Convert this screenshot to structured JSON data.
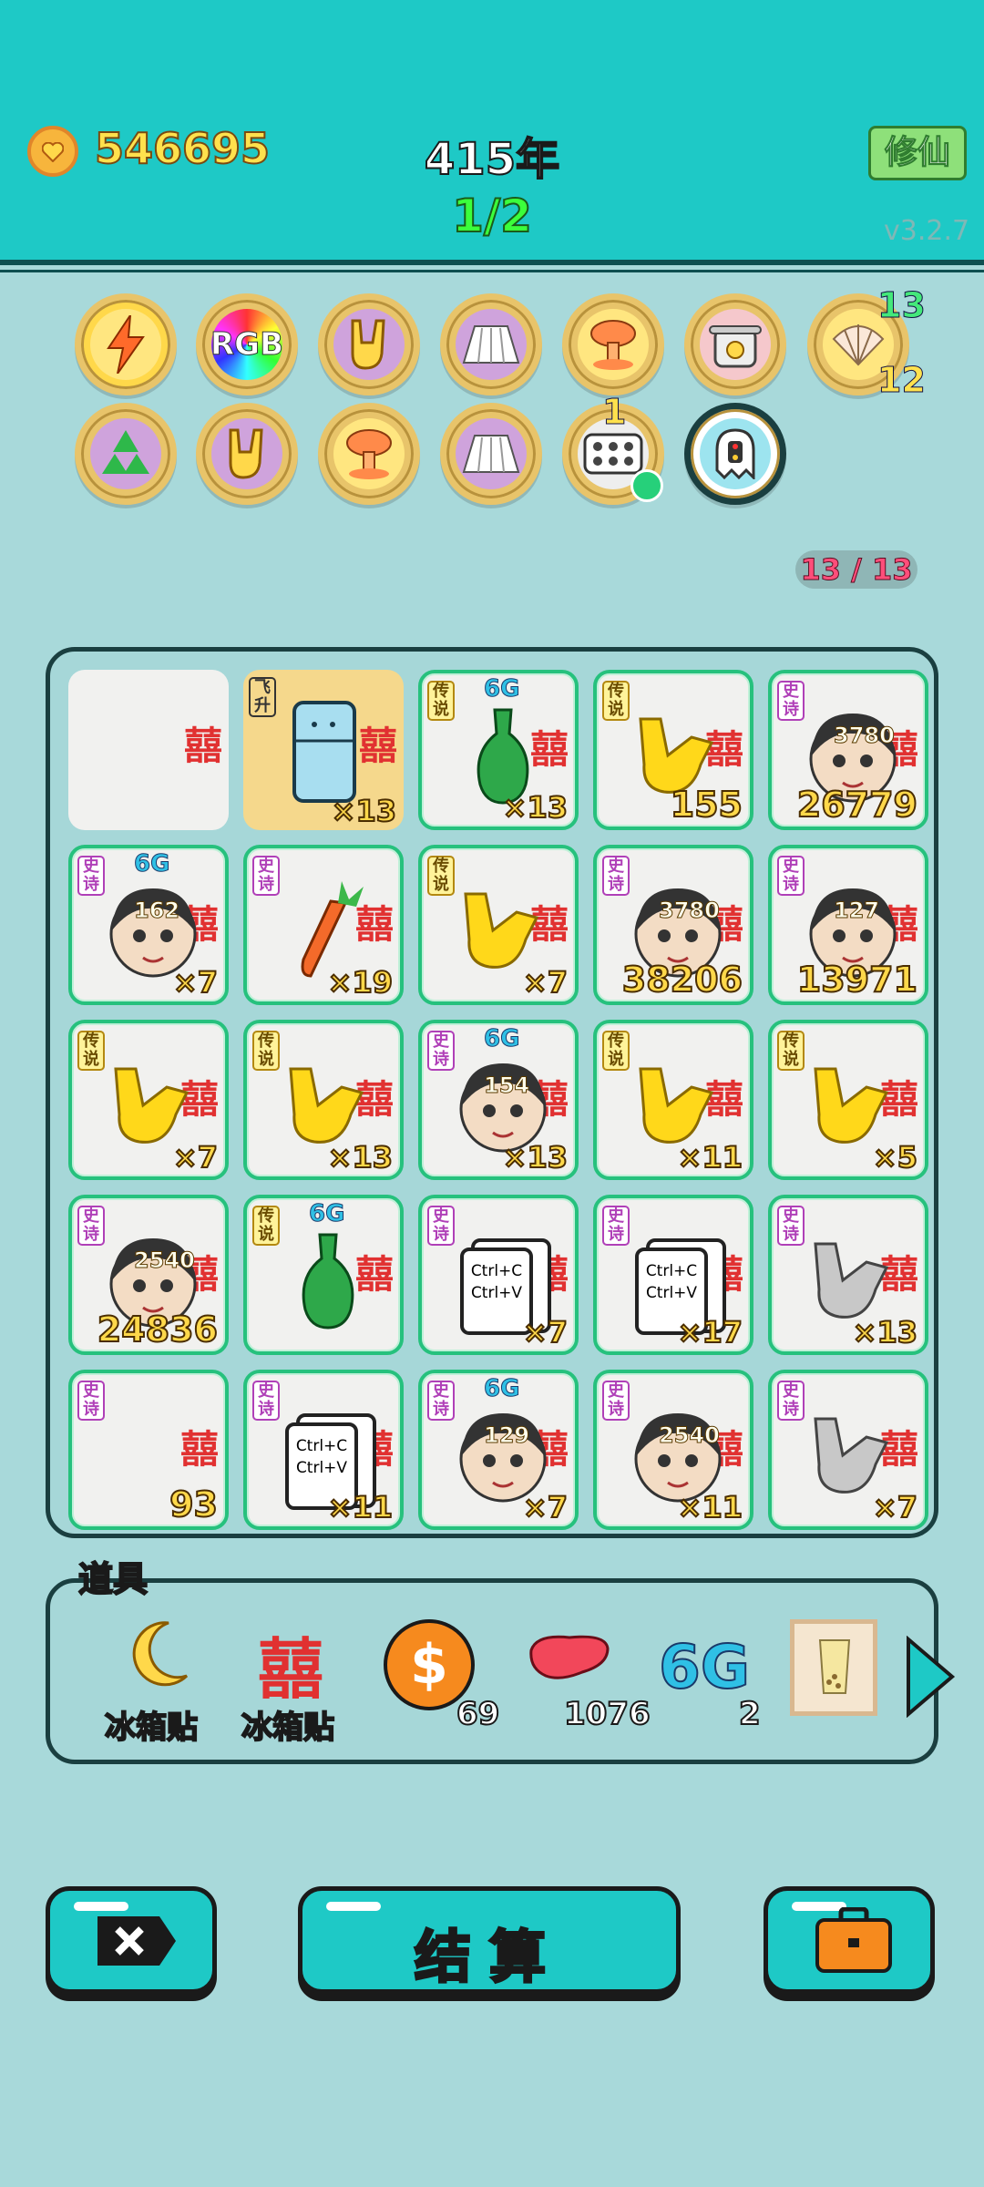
{
  "header": {
    "coins": "546695",
    "year": "415年",
    "round": "1/2",
    "mode_button": "修仙",
    "version": "v3.2.7"
  },
  "relics": {
    "row1": [
      {
        "icon": "lightning-icon"
      },
      {
        "icon": "rgb-icon",
        "text": "RGB"
      },
      {
        "icon": "rock-hand-icon"
      },
      {
        "icon": "skirt-icon"
      },
      {
        "icon": "mushroom-cloud-icon"
      },
      {
        "icon": "rice-cooker-duck-icon"
      },
      {
        "icon": "shell-icon",
        "badge_top": "13",
        "badge_bottom": "12"
      }
    ],
    "row2": [
      {
        "icon": "recycle-icon"
      },
      {
        "icon": "rock-hand-icon"
      },
      {
        "icon": "mushroom-cloud-icon"
      },
      {
        "icon": "skirt-icon"
      },
      {
        "icon": "egg-tray-icon",
        "badge_top": "1"
      },
      {
        "icon": "ghost-icon"
      }
    ],
    "slot_count": "13 / 13"
  },
  "board": {
    "xi_char": "囍",
    "tags": {
      "epic": "史诗",
      "legend": "传说",
      "fly": "飞升"
    },
    "six_g": "6G",
    "cells": [
      {
        "tag": "",
        "count": ""
      },
      {
        "tag": "fly",
        "count": "×13",
        "art": "fridge"
      },
      {
        "tag": "legend",
        "count": "×13",
        "art": "vase",
        "g6": true
      },
      {
        "tag": "legend",
        "count": "155",
        "art": "hand"
      },
      {
        "tag": "epic",
        "count": "26779",
        "art": "face",
        "hp": "3780"
      },
      {
        "tag": "epic",
        "count": "×7",
        "art": "face",
        "hp": "162",
        "g6": true
      },
      {
        "tag": "epic",
        "count": "×19",
        "art": "carrot"
      },
      {
        "tag": "legend",
        "count": "×7",
        "art": "hand"
      },
      {
        "tag": "epic",
        "count": "38206",
        "art": "face",
        "hp": "3780"
      },
      {
        "tag": "epic",
        "count": "13971",
        "art": "face",
        "hp": "127"
      },
      {
        "tag": "legend",
        "count": "×7",
        "art": "hand"
      },
      {
        "tag": "legend",
        "count": "×13",
        "art": "hand"
      },
      {
        "tag": "epic",
        "count": "×13",
        "art": "face",
        "hp": "154",
        "g6": true
      },
      {
        "tag": "legend",
        "count": "×11",
        "art": "hand"
      },
      {
        "tag": "legend",
        "count": "×5",
        "art": "hand"
      },
      {
        "tag": "epic",
        "count": "24836",
        "art": "face",
        "hp": "2540"
      },
      {
        "tag": "legend",
        "count": "",
        "art": "vase",
        "g6": true
      },
      {
        "tag": "epic",
        "count": "×7",
        "art": "ctrl"
      },
      {
        "tag": "epic",
        "count": "×17",
        "art": "ctrl"
      },
      {
        "tag": "epic",
        "count": "×13",
        "art": "greyhand"
      },
      {
        "tag": "epic",
        "count": "93",
        "art": ""
      },
      {
        "tag": "epic",
        "count": "×11",
        "art": "ctrl"
      },
      {
        "tag": "epic",
        "count": "×7",
        "art": "face",
        "hp": "129",
        "g6": true
      },
      {
        "tag": "epic",
        "count": "×11",
        "art": "face",
        "hp": "2540"
      },
      {
        "tag": "epic",
        "count": "×7",
        "art": "greyhand"
      }
    ],
    "ctrl_text_1": "Ctrl+C",
    "ctrl_text_2": "Ctrl+V"
  },
  "props": {
    "title": "道具",
    "items": [
      {
        "icon": "moon-icon",
        "label": "冰箱贴"
      },
      {
        "icon": "xi-icon",
        "label": "冰箱贴"
      },
      {
        "icon": "dollar-coin-icon",
        "count": "69"
      },
      {
        "icon": "liver-icon",
        "count": "1076"
      },
      {
        "icon": "six-g-icon",
        "count": "2"
      },
      {
        "icon": "bubble-tea-icon"
      }
    ]
  },
  "buttons": {
    "settle": "结算"
  },
  "colors": {
    "header": "#1ec9c6",
    "background": "#a8d9da",
    "accent_gold": "#ffd84a"
  }
}
